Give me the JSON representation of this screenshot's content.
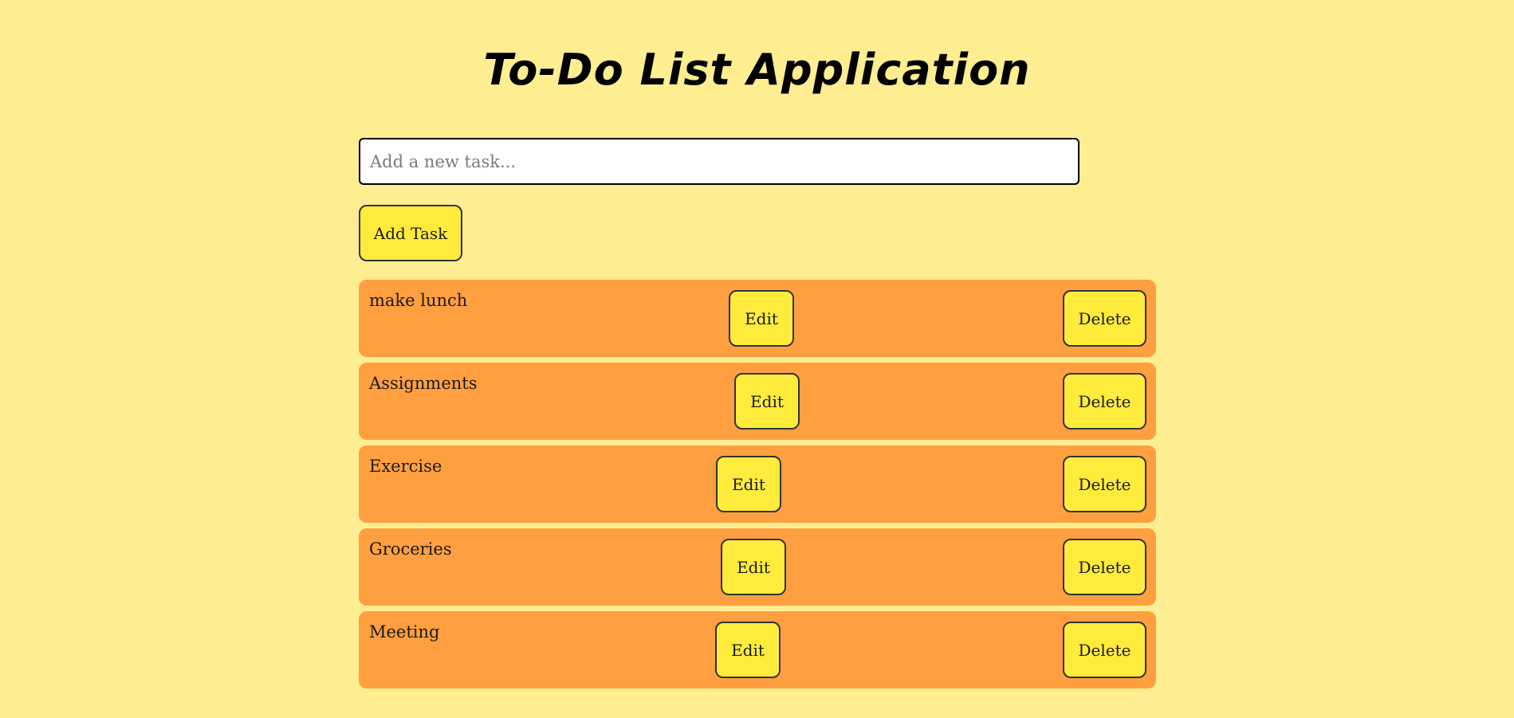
{
  "app": {
    "title": "To-Do List Application"
  },
  "input": {
    "placeholder": "Add a new task...",
    "value": ""
  },
  "add_button": {
    "label": "Add Task"
  },
  "tasks": [
    {
      "text": "make lunch",
      "edit_label": "Edit",
      "delete_label": "Delete"
    },
    {
      "text": "Assignments",
      "edit_label": "Edit",
      "delete_label": "Delete"
    },
    {
      "text": "Exercise",
      "edit_label": "Edit",
      "delete_label": "Delete"
    },
    {
      "text": "Groceries",
      "edit_label": "Edit",
      "delete_label": "Delete"
    },
    {
      "text": "Meeting",
      "edit_label": "Edit",
      "delete_label": "Delete"
    }
  ],
  "colors": {
    "background": "#feee91",
    "task_item": "#ff9f40",
    "button": "#ffeb3b"
  }
}
